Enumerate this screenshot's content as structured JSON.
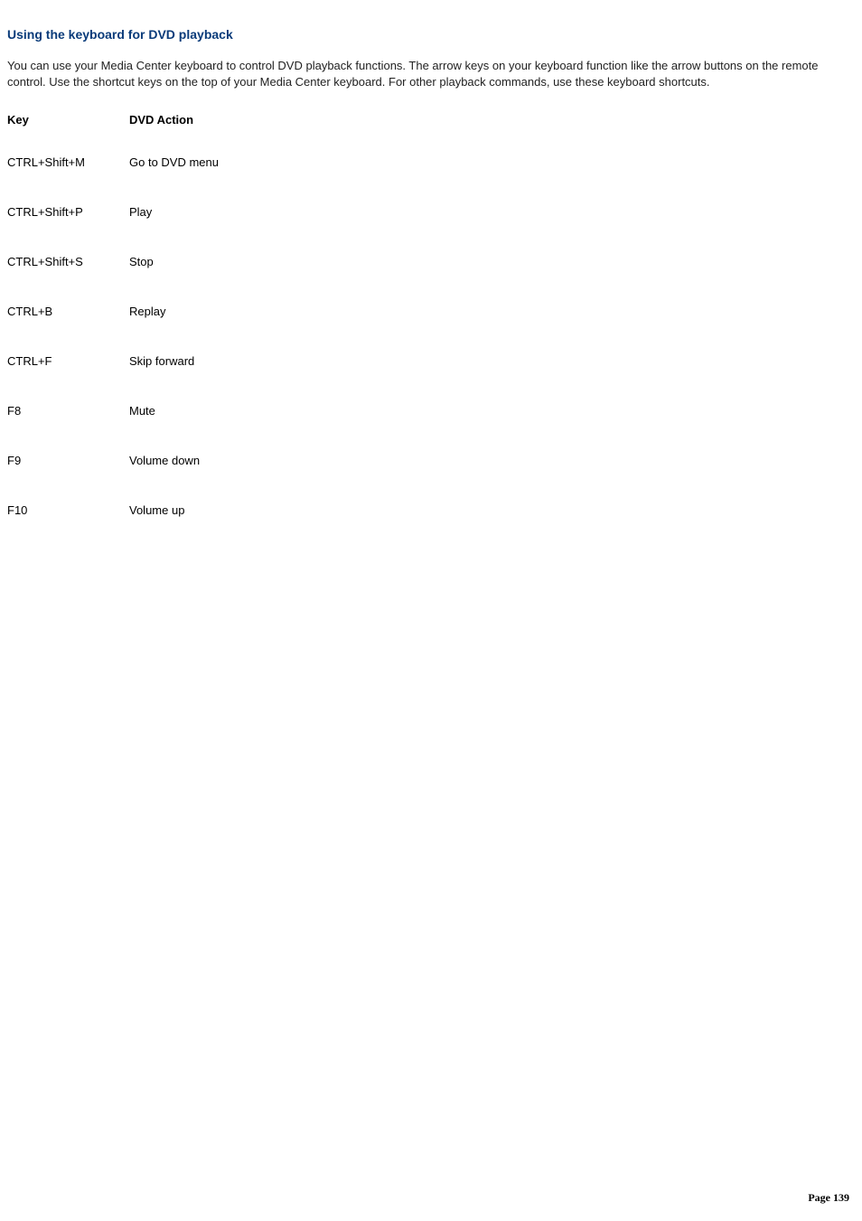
{
  "heading": "Using the keyboard for DVD playback",
  "intro": "You can use your Media Center keyboard to control DVD playback functions. The arrow keys on your keyboard function like the arrow buttons on the remote control. Use the shortcut keys on the top of your Media Center keyboard. For other playback commands, use these keyboard shortcuts.",
  "table": {
    "headers": {
      "key": "Key",
      "action": "DVD Action"
    },
    "rows": [
      {
        "key": "CTRL+Shift+M",
        "action": "Go to DVD menu"
      },
      {
        "key": "CTRL+Shift+P",
        "action": "Play"
      },
      {
        "key": "CTRL+Shift+S",
        "action": "Stop"
      },
      {
        "key": "CTRL+B",
        "action": "Replay"
      },
      {
        "key": "CTRL+F",
        "action": "Skip forward"
      },
      {
        "key": "F8",
        "action": "Mute"
      },
      {
        "key": "F9",
        "action": "Volume down"
      },
      {
        "key": "F10",
        "action": "Volume up"
      }
    ]
  },
  "footer": {
    "label": "Page ",
    "num": "139"
  }
}
